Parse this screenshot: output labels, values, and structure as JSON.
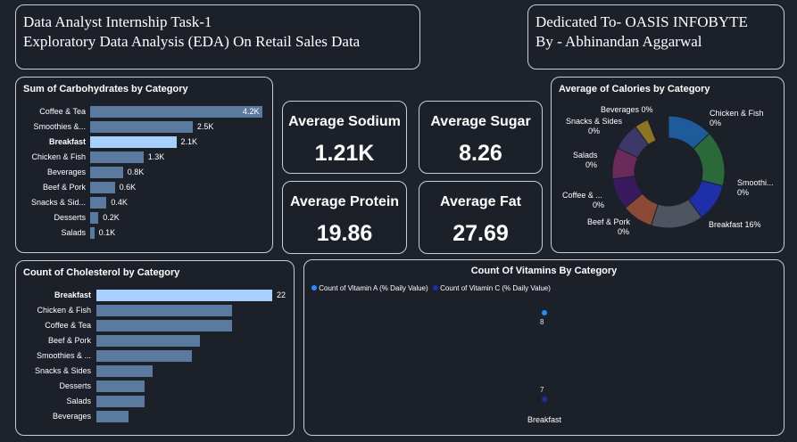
{
  "header": {
    "title_line1": "Data Analyst Internship Task-1",
    "title_line2": "Exploratory Data Analysis (EDA) On Retail Sales Data",
    "dedication_line1": "Dedicated To- OASIS INFOBYTE",
    "dedication_line2": "By - Abhinandan Aggarwal"
  },
  "kpis": [
    {
      "label": "Average Sodium",
      "value": "1.21K"
    },
    {
      "label": "Average Sugar",
      "value": "8.26"
    },
    {
      "label": "Average Protein",
      "value": "19.86"
    },
    {
      "label": "Average Fat",
      "value": "27.69"
    }
  ],
  "colors": {
    "background": "#1d222b",
    "bar": "#5a7aa0",
    "bar_highlight": "#a8d0ff",
    "vitamin_a": "#1e90ff",
    "vitamin_c": "#1f2fa8"
  },
  "chart_data": [
    {
      "type": "bar",
      "title": "Sum of Carbohydrates by Category",
      "orientation": "horizontal",
      "categories": [
        "Coffee & Tea",
        "Smoothies &...",
        "Breakfast",
        "Chicken & Fish",
        "Beverages",
        "Beef & Pork",
        "Snacks & Sid...",
        "Desserts",
        "Salads"
      ],
      "values": [
        4200,
        2500,
        2100,
        1300,
        800,
        600,
        400,
        200,
        100
      ],
      "value_labels": [
        "4.2K",
        "2.5K",
        "2.1K",
        "1.3K",
        "0.8K",
        "0.6K",
        "0.4K",
        "0.2K",
        "0.1K"
      ],
      "highlight": "Breakfast"
    },
    {
      "type": "pie",
      "title": "Average of Calories by Category",
      "slices": [
        {
          "label": "Chicken & Fish",
          "pct_label": "0%",
          "share": 0.13,
          "color": "#1f5b9b"
        },
        {
          "label": "Smoothi...",
          "pct_label": "0%",
          "share": 0.16,
          "color": "#2a6a3a"
        },
        {
          "label": "Breakfast",
          "pct_label": "16%",
          "share": 0.11,
          "color": "#1e2fa8"
        },
        {
          "label": "Beef & Pork",
          "pct_label": "0%",
          "share": 0.15,
          "color": "#4e5561"
        },
        {
          "label": "Coffee & ...",
          "pct_label": "0%",
          "share": 0.09,
          "color": "#8a4a35"
        },
        {
          "label": "Salads",
          "pct_label": "0%",
          "share": 0.09,
          "color": "#3a1a5e"
        },
        {
          "label": "Snacks & Sides",
          "pct_label": "0%",
          "share": 0.09,
          "color": "#6a2a5a"
        },
        {
          "label": "Beverages",
          "pct_label": "0%",
          "share": 0.08,
          "color": "#3e3868"
        },
        {
          "label": "",
          "pct_label": "",
          "share": 0.04,
          "color": "#8c7420"
        }
      ]
    },
    {
      "type": "bar",
      "title": "Count of Cholesterol by Category",
      "orientation": "horizontal",
      "categories": [
        "Breakfast",
        "Chicken & Fish",
        "Coffee & Tea",
        "Beef & Pork",
        "Smoothies & ...",
        "Snacks & Sides",
        "Desserts",
        "Salads",
        "Beverages"
      ],
      "values": [
        22,
        17,
        17,
        13,
        12,
        7,
        6,
        6,
        4
      ],
      "value_labels": [
        "22",
        "",
        "",
        "",
        "",
        "",
        "",
        "",
        ""
      ],
      "highlight": "Breakfast"
    },
    {
      "type": "scatter",
      "title": "Count Of Vitamins By Category",
      "legend": [
        "Count of Vitamin A (% Daily Value)",
        "Count of Vitamin C (% Daily Value)"
      ],
      "ylim": [
        6.8,
        8.2
      ],
      "series": [
        {
          "name": "Count of Vitamin A (% Daily Value)",
          "x": [
            "Breakfast"
          ],
          "values": [
            8
          ]
        },
        {
          "name": "Count of Vitamin C (% Daily Value)",
          "x": [
            "Breakfast"
          ],
          "values": [
            7
          ]
        }
      ],
      "x_tick": "Breakfast"
    }
  ]
}
